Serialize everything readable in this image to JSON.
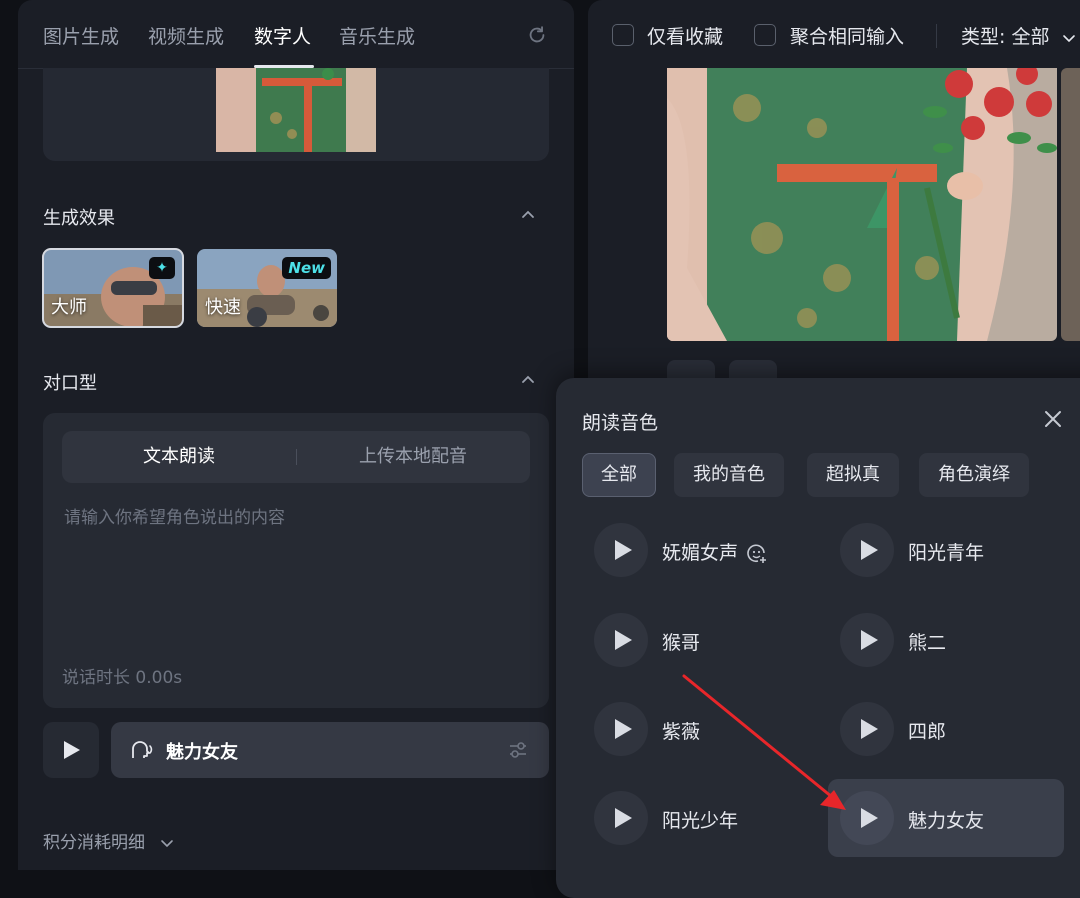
{
  "left_panel": {
    "tabs": [
      {
        "label": "图片生成"
      },
      {
        "label": "视频生成"
      },
      {
        "label": "数字人",
        "active": true
      },
      {
        "label": "音乐生成"
      }
    ],
    "effect_section": {
      "title": "生成效果",
      "cards": [
        {
          "label": "大师",
          "badge_icon": "sparkle-icon",
          "selected": true
        },
        {
          "label": "快速",
          "badge_text": "New",
          "selected": false
        }
      ]
    },
    "lip_section": {
      "title": "对口型",
      "modes": [
        "文本朗读",
        "上传本地配音"
      ],
      "active_mode": "文本朗读",
      "text_input": {
        "value": "",
        "placeholder": "请输入你希望角色说出的内容"
      },
      "duration": "说话时长 0.00s"
    },
    "selected_voice": "魅力女友",
    "credits_detail": "积分消耗明细"
  },
  "right_panel": {
    "favorites_only": {
      "label": "仅看收藏",
      "checked": false
    },
    "merge_same_input": {
      "label": "聚合相同输入",
      "checked": false
    },
    "type_filter": "类型: 全部"
  },
  "voice_popup": {
    "title": "朗读音色",
    "filters": [
      "全部",
      "我的音色",
      "超拟真",
      "角色演绎"
    ],
    "active_filter": "全部",
    "voices": [
      {
        "name": "妩媚女声",
        "extra_icon": "smile-plus-icon"
      },
      {
        "name": "阳光青年"
      },
      {
        "name": "猴哥"
      },
      {
        "name": "熊二"
      },
      {
        "name": "紫薇"
      },
      {
        "name": "四郎"
      },
      {
        "name": "阳光少年"
      },
      {
        "name": "魅力女友",
        "selected": true
      }
    ]
  },
  "colors": {
    "background": "#0f1116",
    "panel": "#1b1e26",
    "card": "#262a33",
    "accent_cyan": "#4de1e8",
    "annotation_arrow": "#e8262a"
  }
}
